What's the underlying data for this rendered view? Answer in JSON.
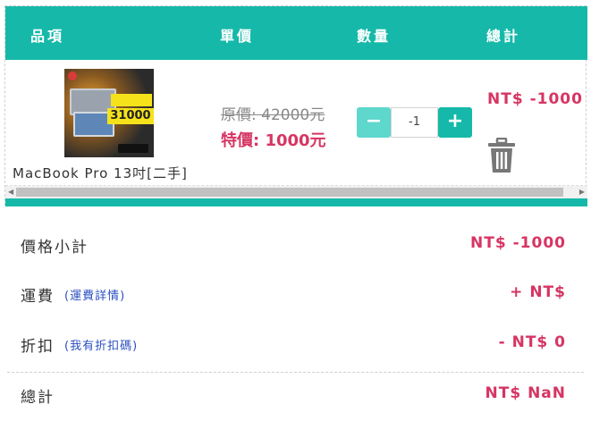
{
  "table_header": {
    "item": "品項",
    "unit_price": "單價",
    "quantity": "數量",
    "total": "總計"
  },
  "cart_item": {
    "name": "MacBook Pro 13吋[二手]",
    "thumbnail_price_text": "31000",
    "original_price": "原價: 42000元",
    "special_price": "特價: 1000元",
    "quantity_value": "-1",
    "minus_label": "−",
    "plus_label": "+",
    "line_total": "NT$ -1000",
    "trash_icon": "trash-icon"
  },
  "summary": {
    "subtotal_label": "價格小計",
    "subtotal_value": "NT$ -1000",
    "shipping_label": "運費",
    "shipping_link": "(運費詳情)",
    "shipping_value": "+ NT$",
    "discount_label": "折扣",
    "discount_link": "(我有折扣碼)",
    "discount_value": "- NT$ 0",
    "total_label": "總計",
    "total_value": "NT$ NaN"
  },
  "colors": {
    "accent": "#16b9a9",
    "accent_light": "#5ed7cc",
    "price": "#d63563",
    "link": "#2a4fc0"
  }
}
